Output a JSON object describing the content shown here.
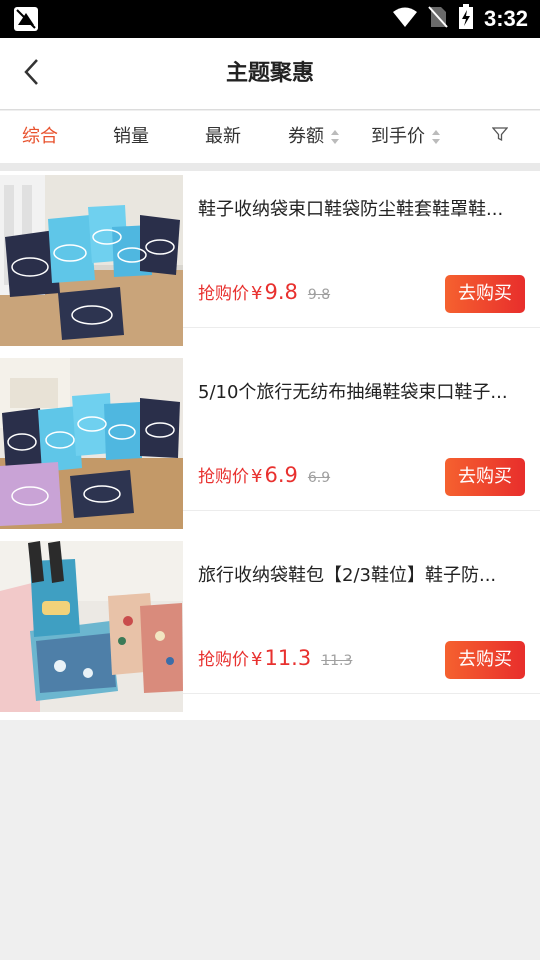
{
  "status_bar": {
    "time": "3:32"
  },
  "header": {
    "title": "主题聚惠"
  },
  "tabs": [
    {
      "label": "综合",
      "active": true
    },
    {
      "label": "销量"
    },
    {
      "label": "最新"
    },
    {
      "label": "券额"
    },
    {
      "label": "到手价"
    }
  ],
  "products": [
    {
      "name": "鞋子收纳袋束口鞋袋防尘鞋套鞋罩鞋...",
      "price_label": "抢购价",
      "currency": "¥",
      "price": "9.8",
      "original_price": "9.8",
      "buy_label": "去购买"
    },
    {
      "name": "5/10个旅行无纺布抽绳鞋袋束口鞋子...",
      "price_label": "抢购价",
      "currency": "¥",
      "price": "6.9",
      "original_price": "6.9",
      "buy_label": "去购买"
    },
    {
      "name": "旅行收纳袋鞋包【2/3鞋位】鞋子防...",
      "price_label": "抢购价",
      "currency": "¥",
      "price": "11.3",
      "original_price": "11.3",
      "buy_label": "去购买"
    }
  ],
  "colors": {
    "accent": "#e8532f",
    "price": "#e8312f",
    "buy_start": "#f5612f",
    "buy_end": "#e82e2c"
  }
}
